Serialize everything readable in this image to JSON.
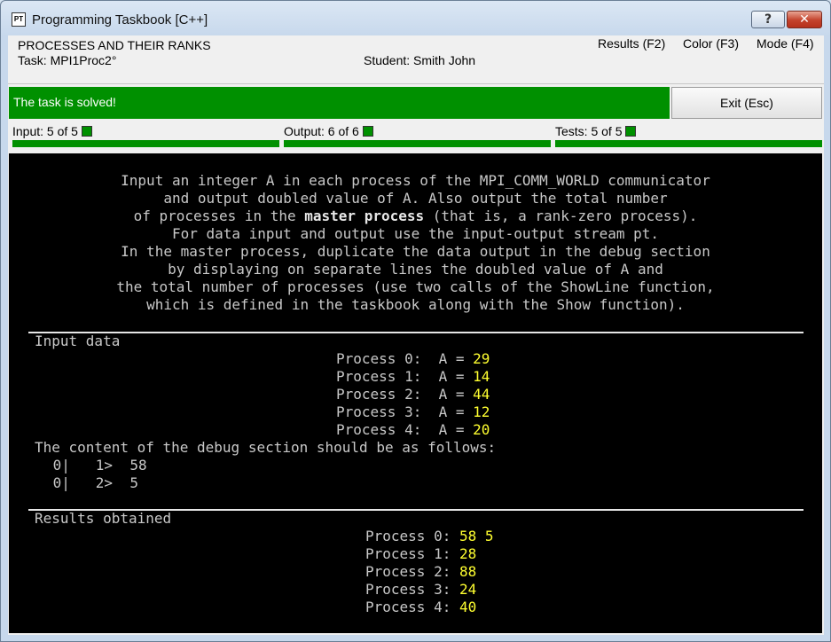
{
  "window": {
    "title": "Programming Taskbook [C++]",
    "icon_text": "PT"
  },
  "header": {
    "topic": "PROCESSES AND THEIR RANKS",
    "task": "Task: MPI1Proc2°",
    "student": "Student: Smith John"
  },
  "menu": {
    "results": "Results (F2)",
    "color": "Color (F3)",
    "mode": "Mode (F4)"
  },
  "status": {
    "text": "The task is solved!",
    "exit_label": "Exit (Esc)",
    "color": "#009000"
  },
  "progress": {
    "input": {
      "label": "Input: 5 of 5",
      "fraction": 1.0
    },
    "output": {
      "label": "Output: 6 of 6",
      "fraction": 1.0
    },
    "tests": {
      "label": "Tests: 5 of 5",
      "fraction": 1.0
    }
  },
  "description": [
    "Input an integer A in each process of the MPI_COMM_WORLD communicator",
    "and output doubled value of A. Also output the total number",
    {
      "pre": "of processes in the ",
      "bold": "master process",
      "post": " (that is, a rank-zero process)."
    },
    "For data input and output use the input-output stream pt.",
    "In the master process, duplicate the data output in the debug section",
    "by displaying on separate lines the doubled value of A and",
    "the total number of processes (use two calls of the ShowLine function,",
    "which is defined in the taskbook along with the Show function)."
  ],
  "input_section": {
    "title": "Input data",
    "rows": [
      {
        "label": "Process 0:  A = ",
        "value": "29"
      },
      {
        "label": "Process 1:  A = ",
        "value": "14"
      },
      {
        "label": "Process 2:  A = ",
        "value": "44"
      },
      {
        "label": "Process 3:  A = ",
        "value": "12"
      },
      {
        "label": "Process 4:  A = ",
        "value": "20"
      }
    ],
    "debug_caption": "The content of the debug section should be as follows:",
    "debug_lines": [
      " 0|   1>  58",
      " 0|   2>  5"
    ]
  },
  "results_section": {
    "title": "Results obtained",
    "rows": [
      {
        "label": "Process 0: ",
        "value": "58 5"
      },
      {
        "label": "Process 1: ",
        "value": "28"
      },
      {
        "label": "Process 2: ",
        "value": "88"
      },
      {
        "label": "Process 3: ",
        "value": "24"
      },
      {
        "label": "Process 4: ",
        "value": "40"
      }
    ]
  },
  "colors": {
    "value_yellow": "#ffff30",
    "console_bg": "#000000",
    "text_gray": "#c8c8c8"
  }
}
